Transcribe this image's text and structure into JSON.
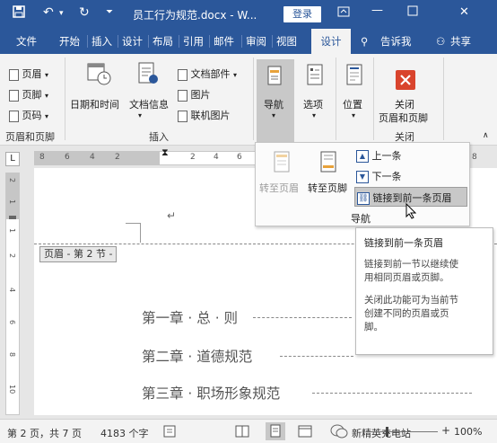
{
  "titlebar": {
    "title": "员工行为规范.docx - W...",
    "login": "登录"
  },
  "tabs": [
    "文件",
    "开始",
    "插入",
    "设计",
    "布局",
    "引用",
    "邮件",
    "审阅",
    "视图",
    "设计"
  ],
  "tell_me": "告诉我",
  "share": "共享",
  "ribbon": {
    "header": "页眉",
    "footer": "页脚",
    "page_number": "页码",
    "group_header_footer": "页眉和页脚",
    "date_time": "日期和时间",
    "doc_info": "文档信息",
    "doc_parts": "文档部件",
    "picture": "图片",
    "online_picture": "联机图片",
    "group_insert": "插入",
    "navigation": "导航",
    "options": "选项",
    "position": "位置",
    "close_line1": "关闭",
    "close_line2": "页眉和页脚",
    "group_close": "关闭"
  },
  "navpanel": {
    "goto_header": "转至页眉",
    "goto_footer": "转至页脚",
    "previous": "上一条",
    "next": "下一条",
    "link_previous": "链接到前一条页眉",
    "group": "导航"
  },
  "tooltip": {
    "title": "链接到前一条页眉",
    "body1": "链接到前一节以继续使\n用相同页眉或页脚。",
    "body2": "关闭此功能可为当前节\n创建不同的页眉或页\n脚。"
  },
  "ruler": {
    "h_numbers": [
      "8",
      "6",
      "4",
      "2",
      "2",
      "4",
      "6",
      "8"
    ],
    "v_numbers": [
      "2",
      "1",
      "1",
      "2",
      "4",
      "6",
      "8",
      "10"
    ]
  },
  "document": {
    "header_tag": "页眉 - 第 2 节 -",
    "toc": [
      "第一章 · 总 · 则",
      "第二章 · 道德规范",
      "第三章 · 职场形象规范"
    ]
  },
  "statusbar": {
    "page": "第 2 页，共 7 页",
    "words": "4183 个字",
    "zoom": "100%",
    "watermark": "新精英充电站"
  },
  "colors": {
    "accent": "#2b579a",
    "close_red": "#d9442d"
  }
}
